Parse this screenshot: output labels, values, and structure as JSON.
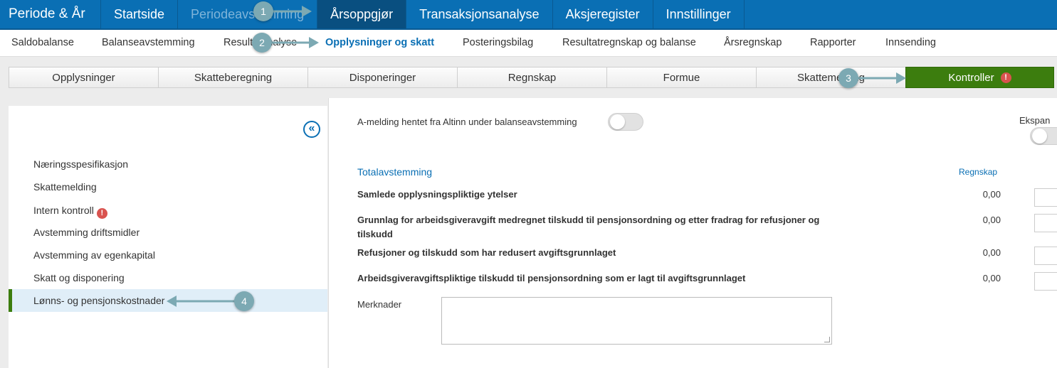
{
  "topnav": {
    "brand": "Periode & År",
    "items": [
      "Startside",
      "Periodeavstemming",
      "Årsoppgjør",
      "Transaksjonsanalyse",
      "Aksjeregister",
      "Innstillinger"
    ]
  },
  "subnav": {
    "items": [
      "Saldobalanse",
      "Balanseavstemming",
      "Resultatanalyse",
      "Opplysninger og skatt",
      "Posteringsbilag",
      "Resultatregnskap og balanse",
      "Årsregnskap",
      "Rapporter",
      "Innsending"
    ]
  },
  "tabs": {
    "items": [
      "Opplysninger",
      "Skatteberegning",
      "Disponeringer",
      "Regnskap",
      "Formue",
      "Skattemelding",
      "Kontroller"
    ],
    "alert": "!"
  },
  "left_panel": {
    "collapse_icon": "«",
    "items": [
      "Næringsspesifikasjon",
      "Skattemelding",
      "Intern kontroll",
      "Avstemming driftsmidler",
      "Avstemming av egenkapital",
      "Skatt og disponering",
      "Lønns- og pensjonskostnader"
    ],
    "alert": "!"
  },
  "right_panel": {
    "amelding_label": "A-melding hentet fra Altinn under balanseavstemming",
    "ekspand_label": "Ekspan",
    "section_title": "Totalavstemming",
    "col_regnskap": "Regnskap",
    "rows": [
      {
        "label": "Samlede opplysningspliktige ytelser",
        "value": "0,00"
      },
      {
        "label": "Grunnlag for arbeidsgiveravgift medregnet tilskudd til pensjonsordning og etter fradrag for refusjoner og tilskudd",
        "value": "0,00"
      },
      {
        "label": "Refusjoner og tilskudd som har redusert avgiftsgrunnlaget",
        "value": "0,00"
      },
      {
        "label": "Arbeidsgiveravgiftspliktige tilskudd til pensjonsordning som er lagt til avgiftsgrunnlaget",
        "value": "0,00"
      }
    ],
    "merknader_label": "Merknader"
  },
  "callouts": [
    "1",
    "2",
    "3",
    "4"
  ],
  "colors": {
    "brand_blue": "#0a6fb4",
    "active_green": "#3c7d0e",
    "alert_red": "#d9534f",
    "callout_teal": "#7ca9b3"
  }
}
